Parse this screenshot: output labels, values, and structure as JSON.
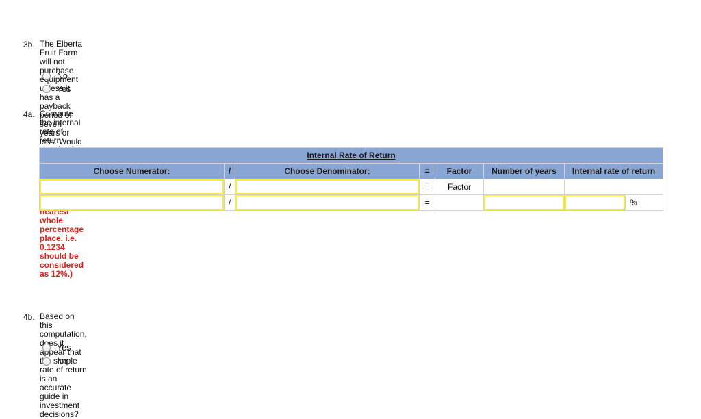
{
  "q3b": {
    "number": "3b.",
    "line1": "The Elberta Fruit Farm will not purchase equipment unless it has a payback period of seven years or",
    "line2": "less. Would the cherry picker be purchased?",
    "options": [
      "No",
      "Yes"
    ]
  },
  "q4a": {
    "number": "4a.",
    "line1_plain": "Compute the internal rate of return promised by the cherry picker. ",
    "line1_red": "(Round you answer to nearest",
    "line2_red": "whole percentage place. i.e. 0.1234 should be considered as 12%.)"
  },
  "irr_table": {
    "title": "Internal Rate of Return",
    "headers": {
      "numerator": "Choose Numerator:",
      "divide": "/",
      "denominator": "Choose Denominator:",
      "equals": "=",
      "factor": "Factor",
      "years": "Number of years",
      "irr": "Internal rate of return"
    },
    "rows": [
      {
        "numerator": "",
        "divide": "/",
        "denominator": "",
        "equals": "=",
        "factor": "Factor",
        "years": "",
        "irr": ""
      },
      {
        "numerator": "",
        "divide": "/",
        "denominator": "",
        "equals": "=",
        "factor": "",
        "years": "",
        "irr": "",
        "irr_unit": "%"
      }
    ]
  },
  "q4b": {
    "number": "4b.",
    "line1": "Based on this computation, does it appear that the simple rate of return is an accurate guide in",
    "line2": "investment decisions?",
    "options": [
      "Yes",
      "No"
    ]
  },
  "colors": {
    "header_bg": "#8aa6d4",
    "input_border": "#f4ee3a",
    "instruction_red": "#e0201b"
  }
}
